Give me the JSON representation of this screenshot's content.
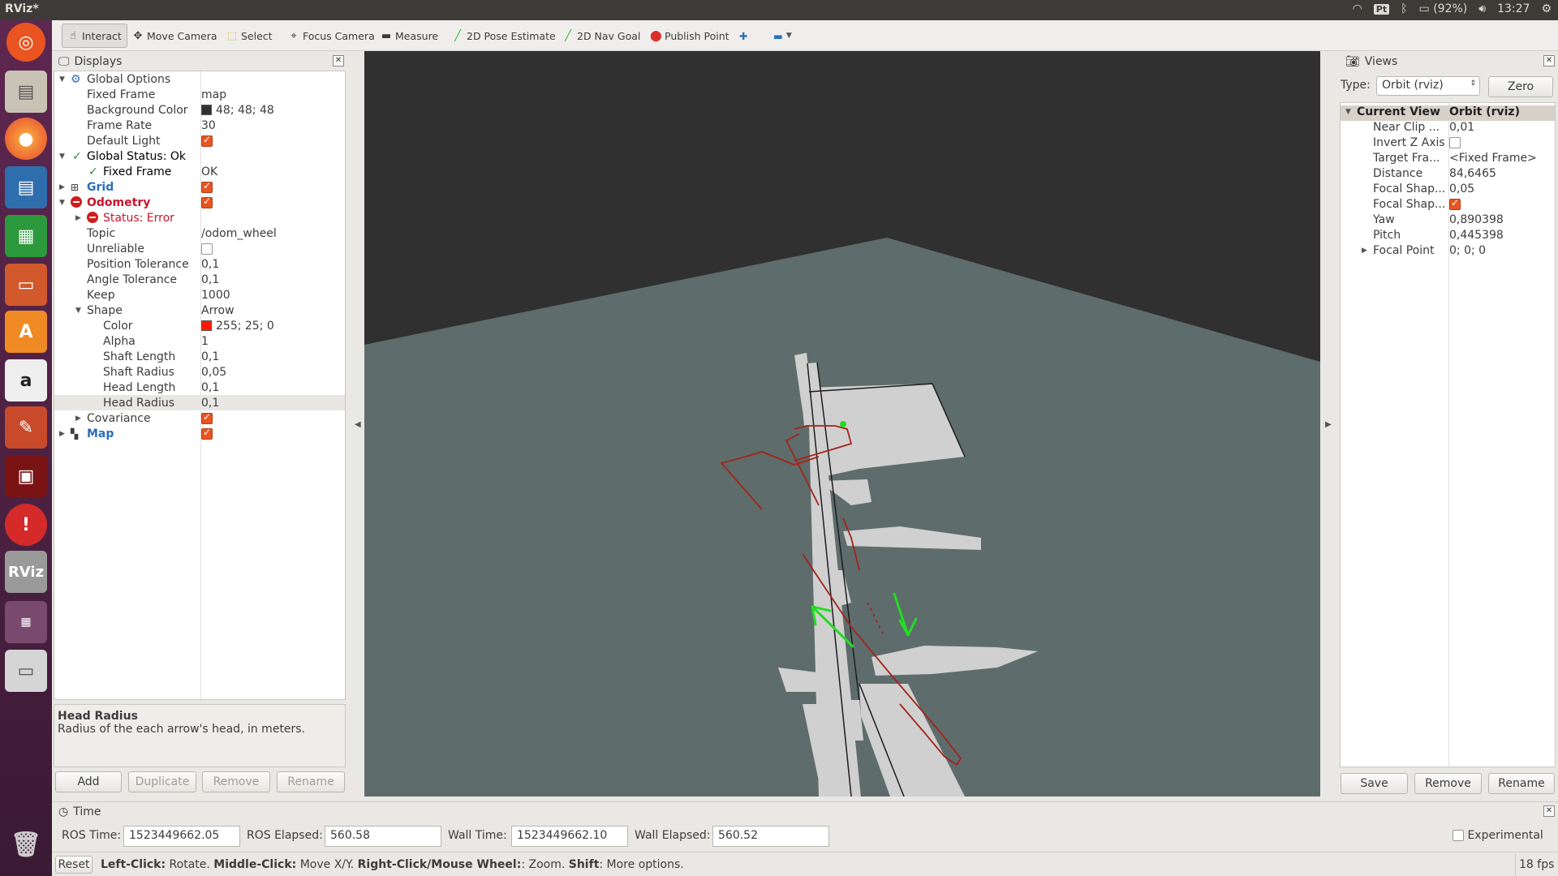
{
  "window": {
    "title": "RViz*"
  },
  "system_tray": {
    "keyboard": "Pt",
    "battery": "(92%)",
    "clock": "13:27"
  },
  "launcher": {
    "items": [
      "ubuntu-logo",
      "files",
      "firefox",
      "writer",
      "calc",
      "impress",
      "software-center",
      "amazon",
      "system-settings",
      "terminal-app",
      "error-report",
      "rviz",
      "workspace-switcher",
      "drive",
      "trash"
    ],
    "rviz_label": "RViz"
  },
  "toolbar": {
    "interact": "Interact",
    "move_camera": "Move Camera",
    "select": "Select",
    "focus_camera": "Focus Camera",
    "measure": "Measure",
    "pose_estimate": "2D Pose Estimate",
    "nav_goal": "2D Nav Goal",
    "publish_point": "Publish Point",
    "plus": "✚",
    "minus": "▬"
  },
  "displays": {
    "title": "Displays",
    "rows": [
      {
        "label": "Global Options",
        "value": ""
      },
      {
        "label": "Fixed Frame",
        "value": "map"
      },
      {
        "label": "Background Color",
        "value": "48; 48; 48"
      },
      {
        "label": "Frame Rate",
        "value": "30"
      },
      {
        "label": "Default Light",
        "value": ""
      },
      {
        "label": "Global Status: Ok",
        "value": ""
      },
      {
        "label": "Fixed Frame",
        "value": "OK"
      },
      {
        "label": "Grid",
        "value": ""
      },
      {
        "label": "Odometry",
        "value": ""
      },
      {
        "label": "Status: Error",
        "value": ""
      },
      {
        "label": "Topic",
        "value": "/odom_wheel"
      },
      {
        "label": "Unreliable",
        "value": ""
      },
      {
        "label": "Position Tolerance",
        "value": "0,1"
      },
      {
        "label": "Angle Tolerance",
        "value": "0,1"
      },
      {
        "label": "Keep",
        "value": "1000"
      },
      {
        "label": "Shape",
        "value": "Arrow"
      },
      {
        "label": "Color",
        "value": "255; 25; 0"
      },
      {
        "label": "Alpha",
        "value": "1"
      },
      {
        "label": "Shaft Length",
        "value": "0,1"
      },
      {
        "label": "Shaft Radius",
        "value": "0,05"
      },
      {
        "label": "Head Length",
        "value": "0,1"
      },
      {
        "label": "Head Radius",
        "value": "0,1"
      },
      {
        "label": "Covariance",
        "value": ""
      },
      {
        "label": "Map",
        "value": ""
      }
    ],
    "help_title": "Head Radius",
    "help_text": "Radius of the each arrow's head, in meters.",
    "buttons": {
      "add": "Add",
      "duplicate": "Duplicate",
      "remove": "Remove",
      "rename": "Rename"
    }
  },
  "views": {
    "title": "Views",
    "type_label": "Type:",
    "type_value": "Orbit (rviz)",
    "zero": "Zero",
    "current_view": "Current View",
    "current_view_type": "Orbit (rviz)",
    "rows": [
      {
        "label": "Near Clip ...",
        "value": "0,01"
      },
      {
        "label": "Invert Z Axis",
        "value": ""
      },
      {
        "label": "Target Fra...",
        "value": "<Fixed Frame>"
      },
      {
        "label": "Distance",
        "value": "84,6465"
      },
      {
        "label": "Focal Shap...",
        "value": "0,05"
      },
      {
        "label": "Focal Shap...",
        "value": ""
      },
      {
        "label": "Yaw",
        "value": "0,890398"
      },
      {
        "label": "Pitch",
        "value": "0,445398"
      },
      {
        "label": "Focal Point",
        "value": "0; 0; 0"
      }
    ],
    "buttons": {
      "save": "Save",
      "remove": "Remove",
      "rename": "Rename"
    }
  },
  "time": {
    "title": "Time",
    "ros_time_label": "ROS Time:",
    "ros_time": "1523449662.05",
    "ros_elapsed_label": "ROS Elapsed:",
    "ros_elapsed": "560.58",
    "wall_time_label": "Wall Time:",
    "wall_time": "1523449662.10",
    "wall_elapsed_label": "Wall Elapsed:",
    "wall_elapsed": "560.52",
    "experimental": "Experimental"
  },
  "status": {
    "reset": "Reset",
    "k1": "Left-Click:",
    "t1": " Rotate. ",
    "k2": "Middle-Click:",
    "t2": " Move X/Y. ",
    "k3": "Right-Click/Mouse Wheel:",
    "t3": ": Zoom. ",
    "k4": "Shift",
    "t4": ": More options.",
    "fps": "18 fps"
  },
  "colors": {
    "odometry_arrows": "#ff1900",
    "grid_floor": "#5e6c6c",
    "background": "#303030",
    "pose_arrows": "#22dd22"
  }
}
